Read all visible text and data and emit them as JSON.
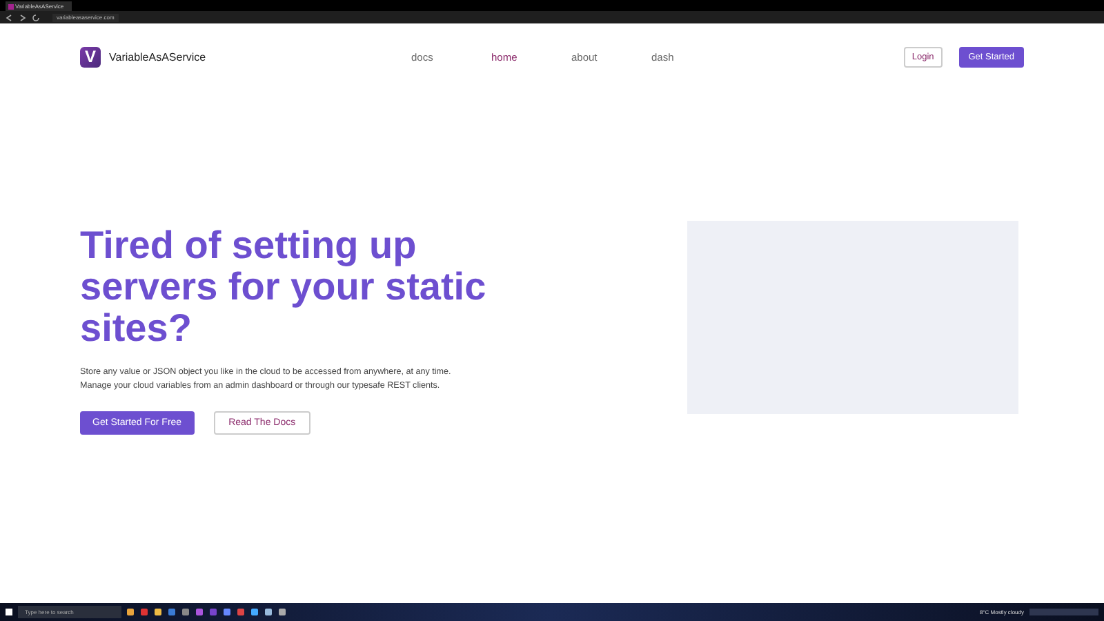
{
  "browser": {
    "tab_title": "VariableAsAService",
    "url": "variableasaservice.com"
  },
  "nav": {
    "brand": "VariableAsAService",
    "logo_letter": "V",
    "links": [
      {
        "label": "docs",
        "selected": false
      },
      {
        "label": "home",
        "selected": true
      },
      {
        "label": "about",
        "selected": false
      },
      {
        "label": "dash",
        "selected": false
      }
    ],
    "login": "Login",
    "get_started": "Get Started"
  },
  "hero": {
    "title": "Tired of setting up servers for your static sites?",
    "description": "Store any value or JSON object you like in the cloud to be accessed from anywhere, at any time. Manage your cloud variables from an admin dashboard or through our typesafe REST clients.",
    "primary_button": "Get Started For Free",
    "secondary_button": "Read The Docs"
  },
  "taskbar": {
    "search_placeholder": "Type here to search",
    "weather": "8°C Mostly cloudy"
  }
}
